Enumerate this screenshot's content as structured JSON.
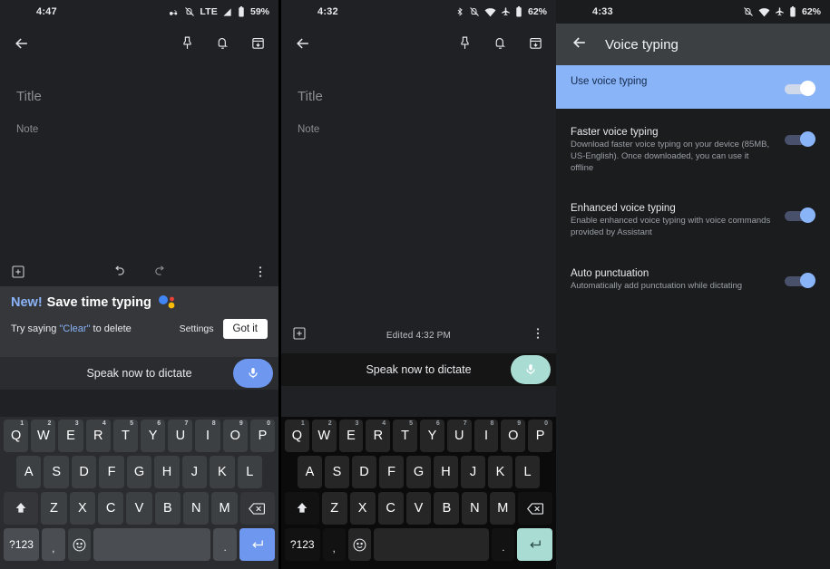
{
  "panels": {
    "left": {
      "status": {
        "clock": "4:47",
        "network": "LTE",
        "battery": "59%",
        "icons": [
          "glasses-icon",
          "bell-off-icon",
          "lte-label",
          "signal-icon",
          "battery-icon"
        ]
      },
      "appbar": {
        "back": "back-arrow",
        "actions": [
          "pin-icon",
          "reminder-bell-icon",
          "archive-icon"
        ]
      },
      "note": {
        "title_placeholder": "Title",
        "body_placeholder": "Note"
      },
      "bottombar": {
        "add": "add-box-icon",
        "undo": "undo-icon",
        "redo": "redo-icon",
        "more": "more-vert-icon"
      },
      "promo": {
        "badge": "New!",
        "headline": "Save time typing",
        "subtitle_prefix": "Try saying ",
        "subtitle_quoted": "\"Clear\"",
        "subtitle_suffix": " to delete",
        "settings_label": "Settings",
        "gotit_label": "Got it"
      },
      "dictate": {
        "label": "Speak now to dictate",
        "mic": "microphone-icon",
        "accent": "#6e97f0"
      },
      "keyboard": {
        "accent": "#6e97f0",
        "row1": [
          {
            "k": "Q",
            "n": "1"
          },
          {
            "k": "W",
            "n": "2"
          },
          {
            "k": "E",
            "n": "3"
          },
          {
            "k": "R",
            "n": "4"
          },
          {
            "k": "T",
            "n": "5"
          },
          {
            "k": "Y",
            "n": "6"
          },
          {
            "k": "U",
            "n": "7"
          },
          {
            "k": "I",
            "n": "8"
          },
          {
            "k": "O",
            "n": "9"
          },
          {
            "k": "P",
            "n": "0"
          }
        ],
        "row2": [
          "A",
          "S",
          "D",
          "F",
          "G",
          "H",
          "J",
          "K",
          "L"
        ],
        "row3": [
          "Z",
          "X",
          "C",
          "V",
          "B",
          "N",
          "M"
        ],
        "sym_label": "?123",
        "comma": ",",
        "period": ".",
        "emoji": "emoji-icon",
        "shift": "shift-icon",
        "backspace": "backspace-icon",
        "enter": "enter-icon",
        "space": ""
      }
    },
    "mid": {
      "status": {
        "clock": "4:32",
        "battery": "62%",
        "icons": [
          "bluetooth-icon",
          "bell-off-icon",
          "wifi-icon",
          "airplane-icon",
          "battery-icon"
        ]
      },
      "appbar": {
        "back": "back-arrow",
        "actions": [
          "pin-icon",
          "reminder-bell-icon",
          "archive-icon"
        ]
      },
      "note": {
        "title_placeholder": "Title",
        "body_placeholder": "Note"
      },
      "bottombar": {
        "add": "add-box-icon",
        "edited": "Edited 4:32 PM",
        "more": "more-vert-icon"
      },
      "dictate": {
        "label": "Speak now to dictate",
        "mic": "microphone-icon",
        "accent": "#a9ddd4"
      },
      "keyboard": {
        "accent": "#a9ddd4",
        "row1": [
          {
            "k": "Q",
            "n": "1"
          },
          {
            "k": "W",
            "n": "2"
          },
          {
            "k": "E",
            "n": "3"
          },
          {
            "k": "R",
            "n": "4"
          },
          {
            "k": "T",
            "n": "5"
          },
          {
            "k": "Y",
            "n": "6"
          },
          {
            "k": "U",
            "n": "7"
          },
          {
            "k": "I",
            "n": "8"
          },
          {
            "k": "O",
            "n": "9"
          },
          {
            "k": "P",
            "n": "0"
          }
        ],
        "row2": [
          "A",
          "S",
          "D",
          "F",
          "G",
          "H",
          "J",
          "K",
          "L"
        ],
        "row3": [
          "Z",
          "X",
          "C",
          "V",
          "B",
          "N",
          "M"
        ],
        "sym_label": "?123",
        "comma": ",",
        "period": ".",
        "emoji": "emoji-icon",
        "shift": "shift-icon",
        "backspace": "backspace-icon",
        "enter": "enter-icon",
        "space": ""
      }
    },
    "right": {
      "status": {
        "clock": "4:33",
        "battery": "62%",
        "icons": [
          "bell-off-icon",
          "wifi-icon",
          "airplane-icon",
          "battery-icon"
        ]
      },
      "appbar": {
        "back": "back-arrow",
        "title": "Voice typing"
      },
      "settings": [
        {
          "name": "Use voice typing",
          "desc": "",
          "toggle": "on",
          "highlighted": true
        },
        {
          "name": "Faster voice typing",
          "desc": "Download faster voice typing on your device (85MB, US-English). Once downloaded, you can use it offline",
          "toggle": "on",
          "highlighted": false
        },
        {
          "name": "Enhanced voice typing",
          "desc": "Enable enhanced voice typing with voice commands provided by Assistant",
          "toggle": "on",
          "highlighted": false
        },
        {
          "name": "Auto punctuation",
          "desc": "Automatically add punctuation while dictating",
          "toggle": "on",
          "highlighted": false
        }
      ]
    }
  }
}
